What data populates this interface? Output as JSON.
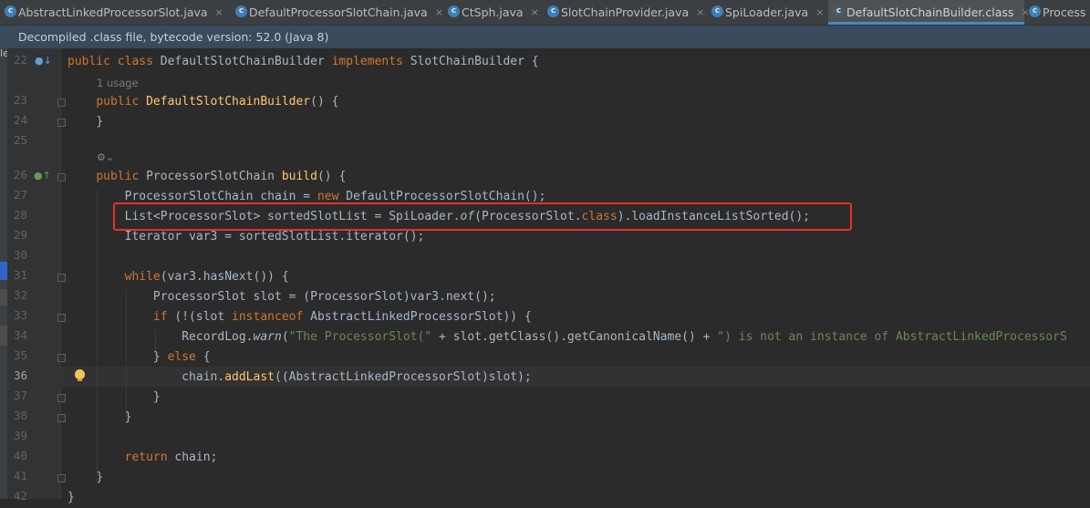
{
  "tabs": [
    {
      "label": "AbstractLinkedProcessorSlot.java",
      "active": false
    },
    {
      "label": "DefaultProcessorSlotChain.java",
      "active": false
    },
    {
      "label": "CtSph.java",
      "active": false
    },
    {
      "label": "SlotChainProvider.java",
      "active": false
    },
    {
      "label": "SpiLoader.java",
      "active": false
    },
    {
      "label": "DefaultSlotChainBuilder.class",
      "active": true
    },
    {
      "label": "Process",
      "active": false
    }
  ],
  "tab_close_glyph": "×",
  "tab_icon_glyph": "c",
  "banner": "Decompiled .class file, bytecode version: 52.0 (Java 8)",
  "strip_fragment": "le",
  "editor": {
    "usage_hint": "1 usage",
    "line_numbers": [
      "22",
      "23",
      "24",
      "25",
      "26",
      "27",
      "28",
      "29",
      "30",
      "31",
      "32",
      "33",
      "34",
      "35",
      "36",
      "37",
      "38",
      "39",
      "40",
      "41",
      "42"
    ],
    "current_line": "36",
    "code": {
      "l22": {
        "kw1": "public",
        "kw2": "class",
        "name": "DefaultSlotChainBuilder",
        "kw3": "implements",
        "iface": "SlotChainBuilder {"
      },
      "l23": {
        "kw": "public",
        "ctor": "DefaultSlotChainBuilder",
        "rest": "() {"
      },
      "l24": "}",
      "l26": {
        "kw": "public",
        "type": "ProcessorSlotChain",
        "method": "build",
        "rest": "() {"
      },
      "l27": {
        "a": "ProcessorSlotChain chain = ",
        "kw": "new",
        "b": " DefaultProcessorSlotChain();"
      },
      "l28": {
        "a": "List<ProcessorSlot> sortedSlotList = SpiLoader.",
        "method": "of",
        "b": "(ProcessorSlot.",
        "kw": "class",
        "c": ").loadInstanceListSorted();"
      },
      "l29": "Iterator var3 = sortedSlotList.iterator();",
      "l31": {
        "kw": "while",
        "rest": "(var3.hasNext()) {"
      },
      "l32": "ProcessorSlot slot = (ProcessorSlot)var3.next();",
      "l33": {
        "kw1": "if",
        "a": " (!(slot ",
        "kw2": "instanceof",
        "b": " AbstractLinkedProcessorSlot)) {"
      },
      "l34": {
        "a": "RecordLog.",
        "method": "warn",
        "b": "(",
        "s1": "\"The ProcessorSlot(\"",
        "c": " + slot.getClass().getCanonicalName() + ",
        "s2": "\") is not an instance of AbstractLinkedProcessorS"
      },
      "l35": {
        "a": "} ",
        "kw": "else",
        "b": " {"
      },
      "l36": {
        "a": "chain.",
        "method": "addLast",
        "b": "((AbstractLinkedProcessorSlot)slot);"
      },
      "l37": "}",
      "l38": "}",
      "l40": {
        "kw": "return",
        "rest": " chain;"
      },
      "l41": "}",
      "l42": "}"
    }
  }
}
